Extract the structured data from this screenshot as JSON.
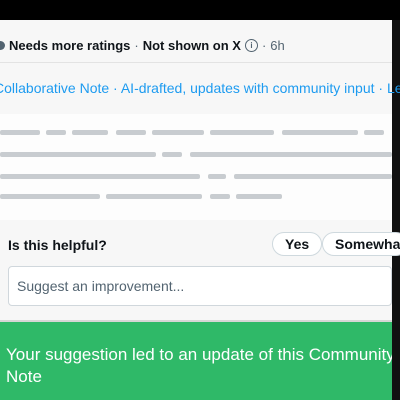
{
  "note": {
    "status": "Needs more ratings",
    "visibility": "Not shown on X",
    "separator": "·",
    "time": "6h",
    "info_icon": "info-icon",
    "collab_text": "Collaborative Note · AI-drafted, updates with community input · Le"
  },
  "rating": {
    "question": "Is this helpful?",
    "options": [
      "Yes",
      "Somewhat"
    ]
  },
  "suggestion": {
    "placeholder": "Suggest an improvement..."
  },
  "toast": {
    "message": "Your suggestion led to an update of this Community Note"
  },
  "colors": {
    "accent": "#1d9bf0",
    "toast_bg": "#2fb968",
    "text": "#0f1419",
    "muted": "#536471"
  }
}
